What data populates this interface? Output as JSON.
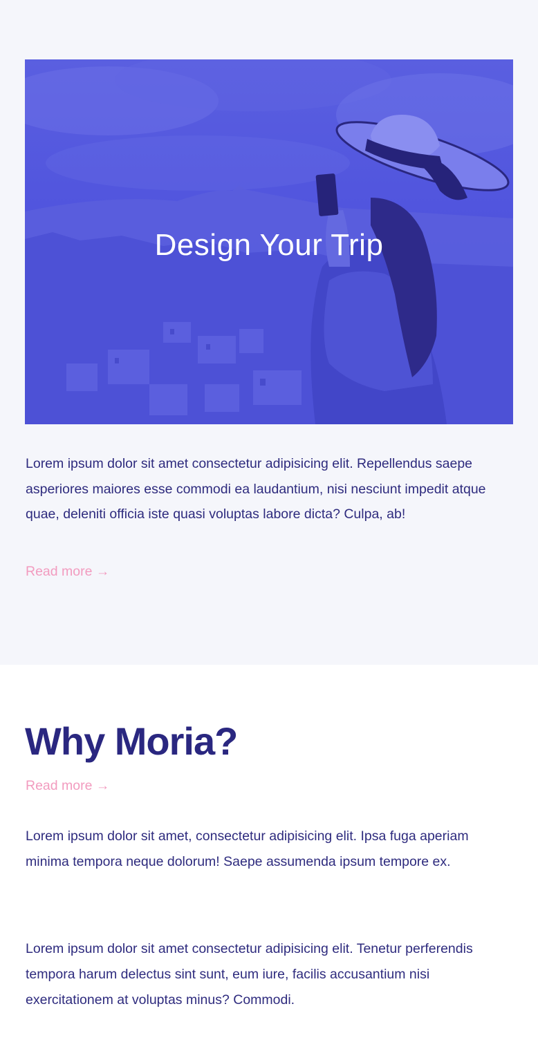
{
  "trip": {
    "hero_title": "Design Your Trip",
    "paragraph": "Lorem ipsum dolor sit amet consectetur adipisicing elit. Repellendus saepe asperiores maiores esse commodi ea laudantium, nisi nesciunt impedit atque quae, deleniti officia iste quasi voluptas labore dicta? Culpa, ab!",
    "read_more": "Read more →"
  },
  "why": {
    "title": "Why Moria?",
    "read_more": "Read more →",
    "paragraph_1": "Lorem ipsum dolor sit amet, consectetur adipisicing elit. Ipsa fuga aperiam minima tempora neque dolorum! Saepe assumenda ipsum tempore ex.",
    "paragraph_2": "Lorem ipsum dolor sit amet consectetur adipisicing elit. Tenetur perferendis tempora harum delectus sint sunt, eum iure, facilis accusantium nisi exercitationem at voluptas minus? Commodi."
  },
  "colors": {
    "hero_overlay": "#5155de",
    "text": "#2e2b7e",
    "heading": "#2a2780",
    "link": "#f29bbf",
    "section_bg": "#f5f6fb"
  }
}
